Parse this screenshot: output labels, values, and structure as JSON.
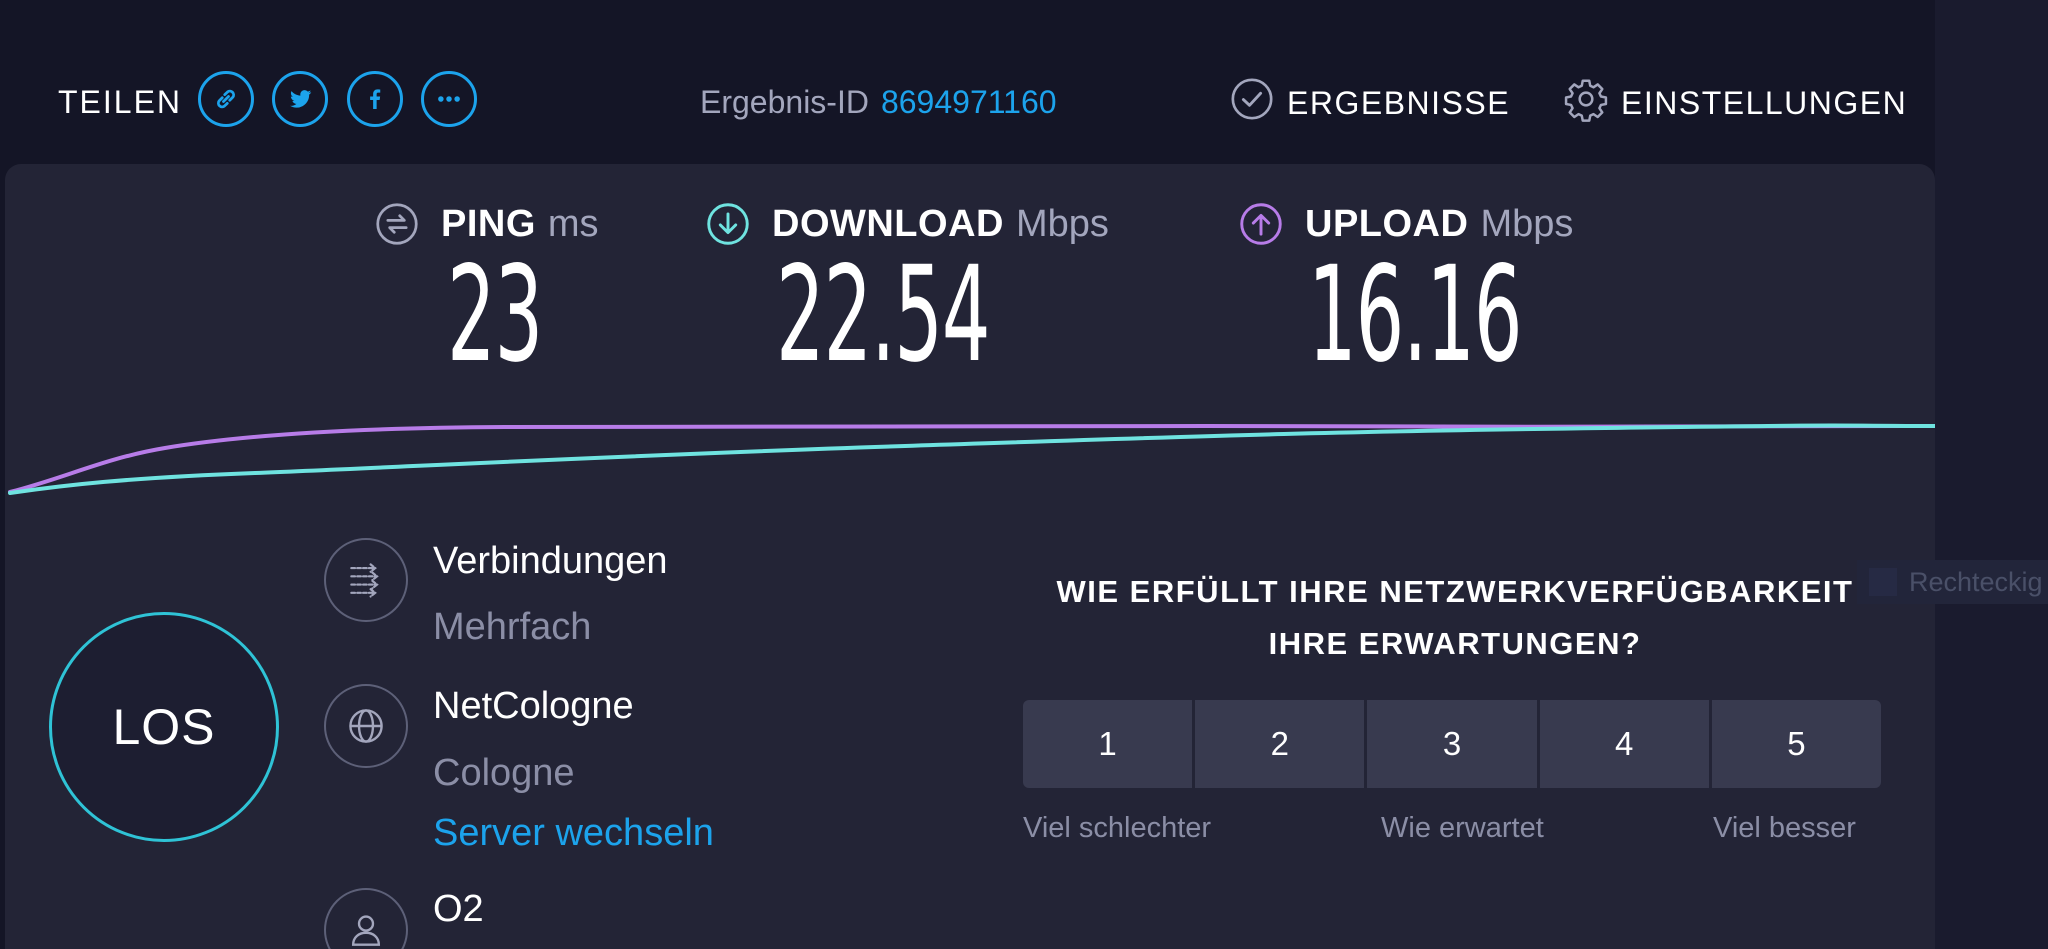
{
  "header": {
    "share_label": "TEILEN",
    "share_buttons": [
      "link-icon",
      "twitter-icon",
      "facebook-icon",
      "more-icon"
    ],
    "result_id_label": "Ergebnis-ID",
    "result_id_value": "8694971160",
    "results_label": "ERGEBNISSE",
    "settings_label": "EINSTELLUNGEN"
  },
  "metrics": {
    "ping": {
      "label": "PING",
      "unit": "ms",
      "value": "23"
    },
    "download": {
      "label": "DOWNLOAD",
      "unit": "Mbps",
      "value": "22.54"
    },
    "upload": {
      "label": "UPLOAD",
      "unit": "Mbps",
      "value": "16.16"
    }
  },
  "colors": {
    "accent_blue": "#1ca3ec",
    "download": "#6fe3e0",
    "upload": "#b77ce8",
    "background": "#141526",
    "panel": "#232436"
  },
  "go_button": {
    "label": "LOS"
  },
  "connections": {
    "title": "Verbindungen",
    "value": "Mehrfach"
  },
  "server": {
    "name": "NetCologne",
    "location": "Cologne",
    "change_label": "Server wechseln"
  },
  "provider": {
    "name": "O2"
  },
  "survey": {
    "question_line1": "WIE ERFÜLLT IHRE NETZWERKVERFÜGBARKEIT",
    "question_line2": "IHRE ERWARTUNGEN?",
    "options": [
      "1",
      "2",
      "3",
      "4",
      "5"
    ],
    "scale_low": "Viel schlechter",
    "scale_mid": "Wie erwartet",
    "scale_high": "Viel besser"
  },
  "overlay_tooltip": "Rechteckig"
}
